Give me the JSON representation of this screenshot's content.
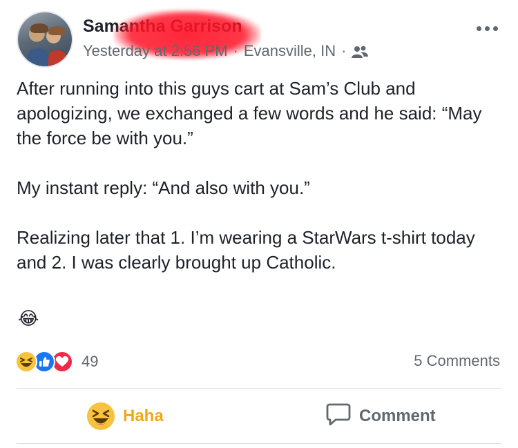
{
  "post": {
    "author_name": "Samantha Garrison",
    "timestamp": "Yesterday at 2:56 PM",
    "location": "Evansville, IN",
    "separator": "·",
    "audience_icon": "friends-icon",
    "more_icon": "more-options-icon",
    "paragraphs": [
      "After running into this guys cart at Sam’s Club and apologizing, we exchanged a few words and he said: “May the force be with you.”",
      "My instant reply: “And also with you.”",
      "Realizing later that 1. I’m wearing a StarWars t-shirt today and 2. I was clearly brought up Catholic."
    ],
    "trailing_emoji": "😂"
  },
  "reactions": {
    "icons": [
      "haha-icon",
      "like-icon",
      "love-icon"
    ],
    "count": "49",
    "comments": "5 Comments"
  },
  "actions": {
    "haha_label": "Haha",
    "comment_label": "Comment"
  },
  "colors": {
    "haha_active": "#f0a818",
    "like_blue": "#1877f2",
    "love_red": "#f0284a",
    "secondary_text": "#606770",
    "redaction": "#ff1428"
  }
}
